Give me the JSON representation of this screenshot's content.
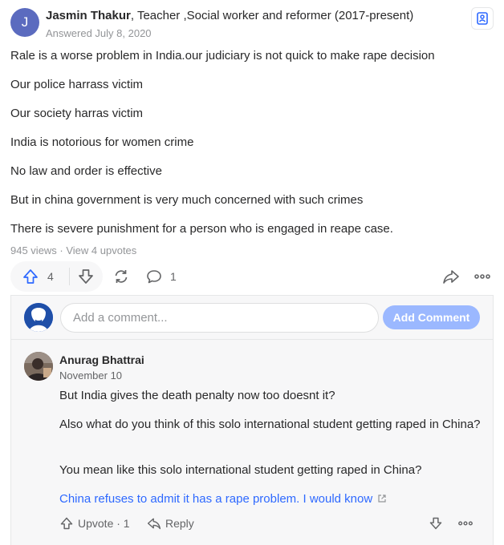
{
  "answer": {
    "author_initial": "J",
    "author_name": "Jasmin Thakur",
    "author_credential": ", Teacher ,Social worker and reformer (2017-present)",
    "answered_date": "Answered July 8, 2020",
    "paragraphs": [
      "Rale is a worse problem in India.our judiciary is not quick to make rape decision",
      "Our police harrass victim",
      "Our society harras victim",
      "India is notorious for women crime",
      "No law and order is effective",
      "But in china government is very much concerned with such crimes",
      "There is severe punishment for a person who is engaged in reape case."
    ],
    "views_text": "945 views · View 4 upvotes",
    "upvote_count": "4",
    "comment_count": "1"
  },
  "comment_form": {
    "placeholder": "Add a comment...",
    "button_label": "Add Comment"
  },
  "comment": {
    "author": "Anurag Bhattrai",
    "date": "November 10",
    "paragraphs": [
      "But India gives the death penalty now too doesnt it?",
      "Also what do you think of this solo international student getting raped in China?",
      "You mean like this solo international student getting raped in China?"
    ],
    "link_text": "China refuses to admit it has a rape problem. I would know",
    "upvote_label": "Upvote · 1",
    "reply_label": "Reply"
  },
  "colors": {
    "accent": "#2e69ff",
    "add_button": "#9bb8ff",
    "avatar_j": "#5b6bbf"
  }
}
